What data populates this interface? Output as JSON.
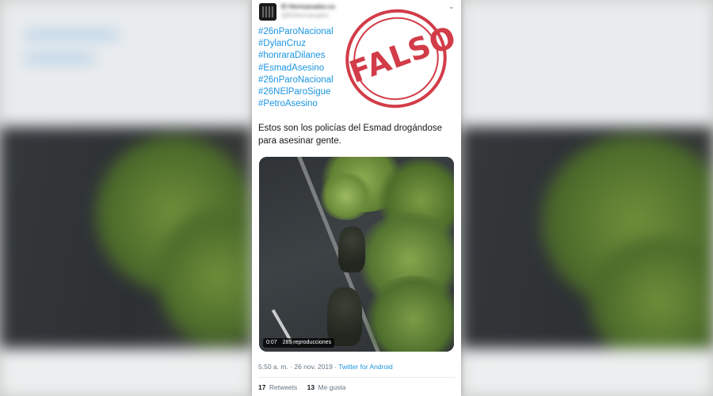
{
  "tweet": {
    "display_name": "El Hermanador.co",
    "handle": "@ElHermanador",
    "hashtags": [
      "#26nParoNacional",
      "#DylanCruz",
      "#honraraDilanes",
      "#EsmadAsesino",
      "#26nParoNacional",
      "#26NElParoSigue",
      "#PetroAsesino"
    ],
    "body_text": "Estos son los policías del Esmad drogándose para asesinar gente.",
    "video": {
      "duration": "0:07",
      "views": "285 reproducciones"
    },
    "time": "5:50 a. m. · 26 nov. 2019 · ",
    "via": "Twitter for Android",
    "retweets_count": "17",
    "retweets_label": "Retweets",
    "likes_count": "13",
    "likes_label": "Me gusta"
  },
  "stamp": {
    "text": "FALSO",
    "color": "#cf2e3b"
  },
  "colors": {
    "link": "#1b95e0",
    "text": "#14171a",
    "muted": "#657786"
  }
}
